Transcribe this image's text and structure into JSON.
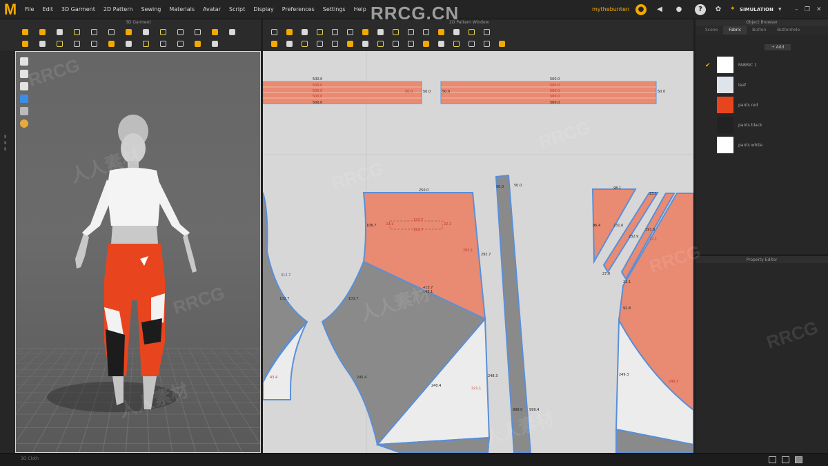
{
  "app": {
    "logo": "M"
  },
  "menu": [
    "File",
    "Edit",
    "3D Garment",
    "2D Pattern",
    "Sewing",
    "Materials",
    "Avatar",
    "Script",
    "Display",
    "Preferences",
    "Settings",
    "Help"
  ],
  "header": {
    "watermark_title": "RRCG.CN",
    "user_name": "mythebunten",
    "mode": "SIMULATION"
  },
  "toolbar_3d": {
    "title": "3D Garment"
  },
  "toolbar_2d": {
    "title": "2D Pattern Window"
  },
  "viewport3d": {
    "tools": [
      "shirt-icon",
      "shirt-icon",
      "avatar-icon",
      "texture-icon",
      "ruler-icon",
      "light-icon"
    ],
    "avatar": {
      "top_color": "#ffffff",
      "pants_color": "#e8451f",
      "pants_trim_color": "#f2f2f2",
      "pants_cuff_color": "#1a1a1a"
    }
  },
  "pattern": {
    "fill_colors": {
      "salmon": "#e98a72",
      "gray": "#8a8a8a",
      "white": "#ececec",
      "outline": "#5a8fd8"
    },
    "bands": [
      {
        "top_label": "500.0",
        "labels": [
          "500.0",
          "500.0",
          "500.0"
        ],
        "side_left": "50.0",
        "side_right": "50.0",
        "bottom_label": "500.0"
      },
      {
        "top_label": "500.0",
        "labels": [
          "500.0",
          "500.0",
          "500.0"
        ],
        "side_left": "50.0",
        "side_right": "50.0",
        "bottom_label": "500.0"
      }
    ],
    "measurements": {
      "panel_top": "250.0",
      "pocket_a": "123.7",
      "pocket_b": "122.7",
      "pocket_side_left": "22.1",
      "pocket_side_right": "22.1",
      "side_right_a": "292.7",
      "side_right_b": "283.1",
      "crotch_a": "312.7",
      "crotch_b": "106.7",
      "seam_a": "413.7",
      "seam_b": "143.1",
      "inseam_left": "102.7",
      "inseam_right": "103.7",
      "lower_right": "248.3",
      "lower_inner": "221.1",
      "lower_mid": "240.4",
      "strip_top": "50.0",
      "strip_top_b": "50.0",
      "strip_bottom": "998.0",
      "strip_bottom_b": "999.4",
      "right_top": "98.1",
      "right_top_b": "23.1",
      "right_a": "231.6",
      "right_b": "191.6",
      "right_c": "232.9",
      "right_d": "96.4",
      "right_e": "27.9",
      "right_f": "32.1",
      "right_g": "92.8",
      "right_h": "249.3",
      "right_i": "22.1",
      "right_j": "249.3",
      "bottom_left": "43.4",
      "bottom_right": "245.4"
    }
  },
  "object_browser": {
    "title": "Object Browser",
    "tabs": [
      "Scene",
      "Fabric",
      "Button",
      "Buttonhole"
    ],
    "active_tab": "Fabric",
    "add_label": "+ Add",
    "fabrics": [
      {
        "name": "FABRIC 1",
        "color": "#ffffff",
        "checked": true
      },
      {
        "name": "leaf",
        "color": "#dfe4ea",
        "checked": false
      },
      {
        "name": "pants red",
        "color": "#e8451f",
        "checked": false
      },
      {
        "name": "pants black",
        "color": "#222222",
        "checked": false
      },
      {
        "name": "pants white",
        "color": "#ffffff",
        "checked": false
      }
    ]
  },
  "property_editor": {
    "title": "Property Editor"
  },
  "status": {
    "text": "3D Cloth"
  },
  "watermarks": [
    "RRCG",
    "人人素材",
    "RRCG",
    "人人素材",
    "RRCG",
    "人人素材",
    "RRCG",
    "RRCG"
  ]
}
